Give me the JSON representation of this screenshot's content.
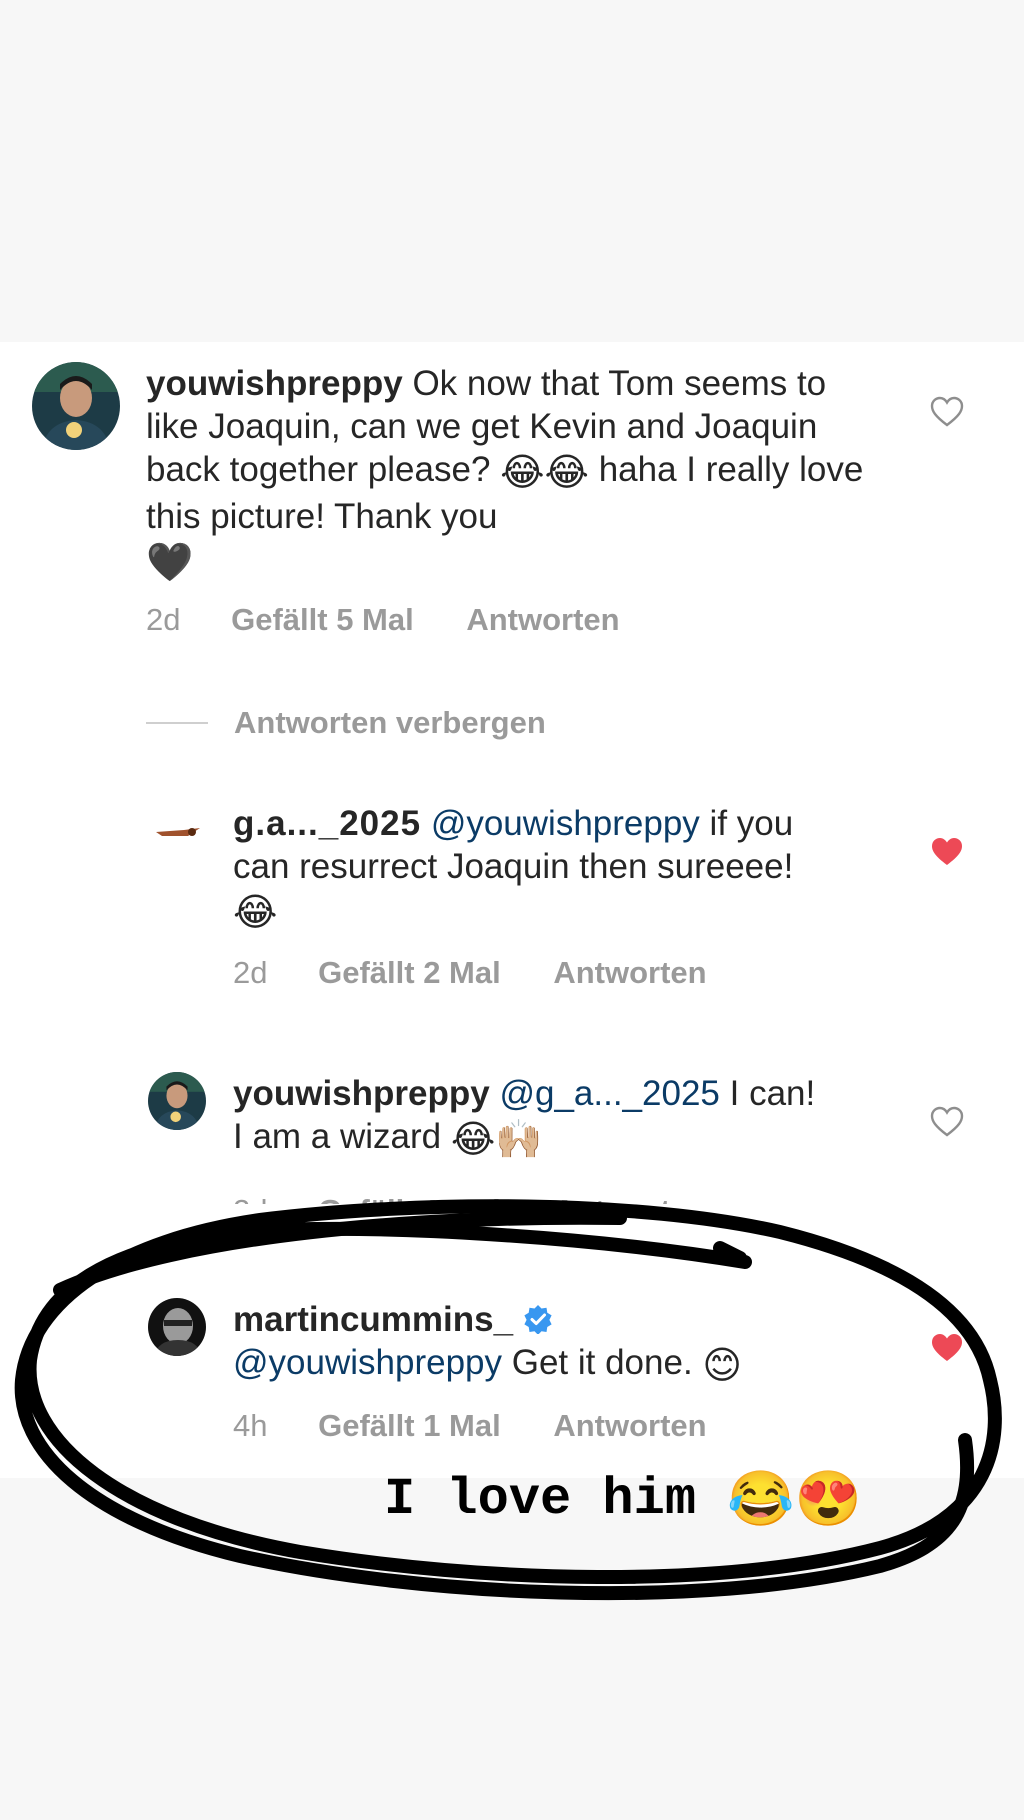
{
  "comments": [
    {
      "username": "youwishpreppy",
      "text": "Ok now that Tom seems to like Joaquin, can we get Kevin and Joaquin back together please?",
      "text2": "haha I really love this picture! Thank you",
      "emoji_a": "😂😂",
      "emoji_b": "🖤",
      "time": "2d",
      "likes": "Gefällt 5 Mal",
      "reply": "Antworten",
      "liked": false
    },
    {
      "username_partial": "g.a..._2025",
      "mention": "@youwishpreppy",
      "text": "if you can resurrect Joaquin then sureeee!",
      "emoji": "😂",
      "time": "2d",
      "likes": "Gefällt 2 Mal",
      "reply": "Antworten",
      "liked": true
    },
    {
      "username": "youwishpreppy",
      "mention": "@g_a..._2025",
      "text": "I can! I am a wizard",
      "emoji": "😂🙌🏼",
      "time": "2d",
      "likes": "Gefällt 1 Mal",
      "reply": "Antworten",
      "liked": false
    },
    {
      "username": "martincummins_",
      "verified": true,
      "mention": "@youwishpreppy",
      "text": "Get it done.",
      "emoji": "😊",
      "time": "4h",
      "likes": "Gefällt 1 Mal",
      "reply": "Antworten",
      "liked": true
    }
  ],
  "hide_replies": "Antworten verbergen",
  "caption": {
    "text": "I love him",
    "emoji": "😂😍"
  },
  "colors": {
    "heart_liked": "#ed4956",
    "mention": "#0b3b66",
    "meta": "#9a9a9a",
    "verified": "#3897f0",
    "scribble": "#000000"
  }
}
